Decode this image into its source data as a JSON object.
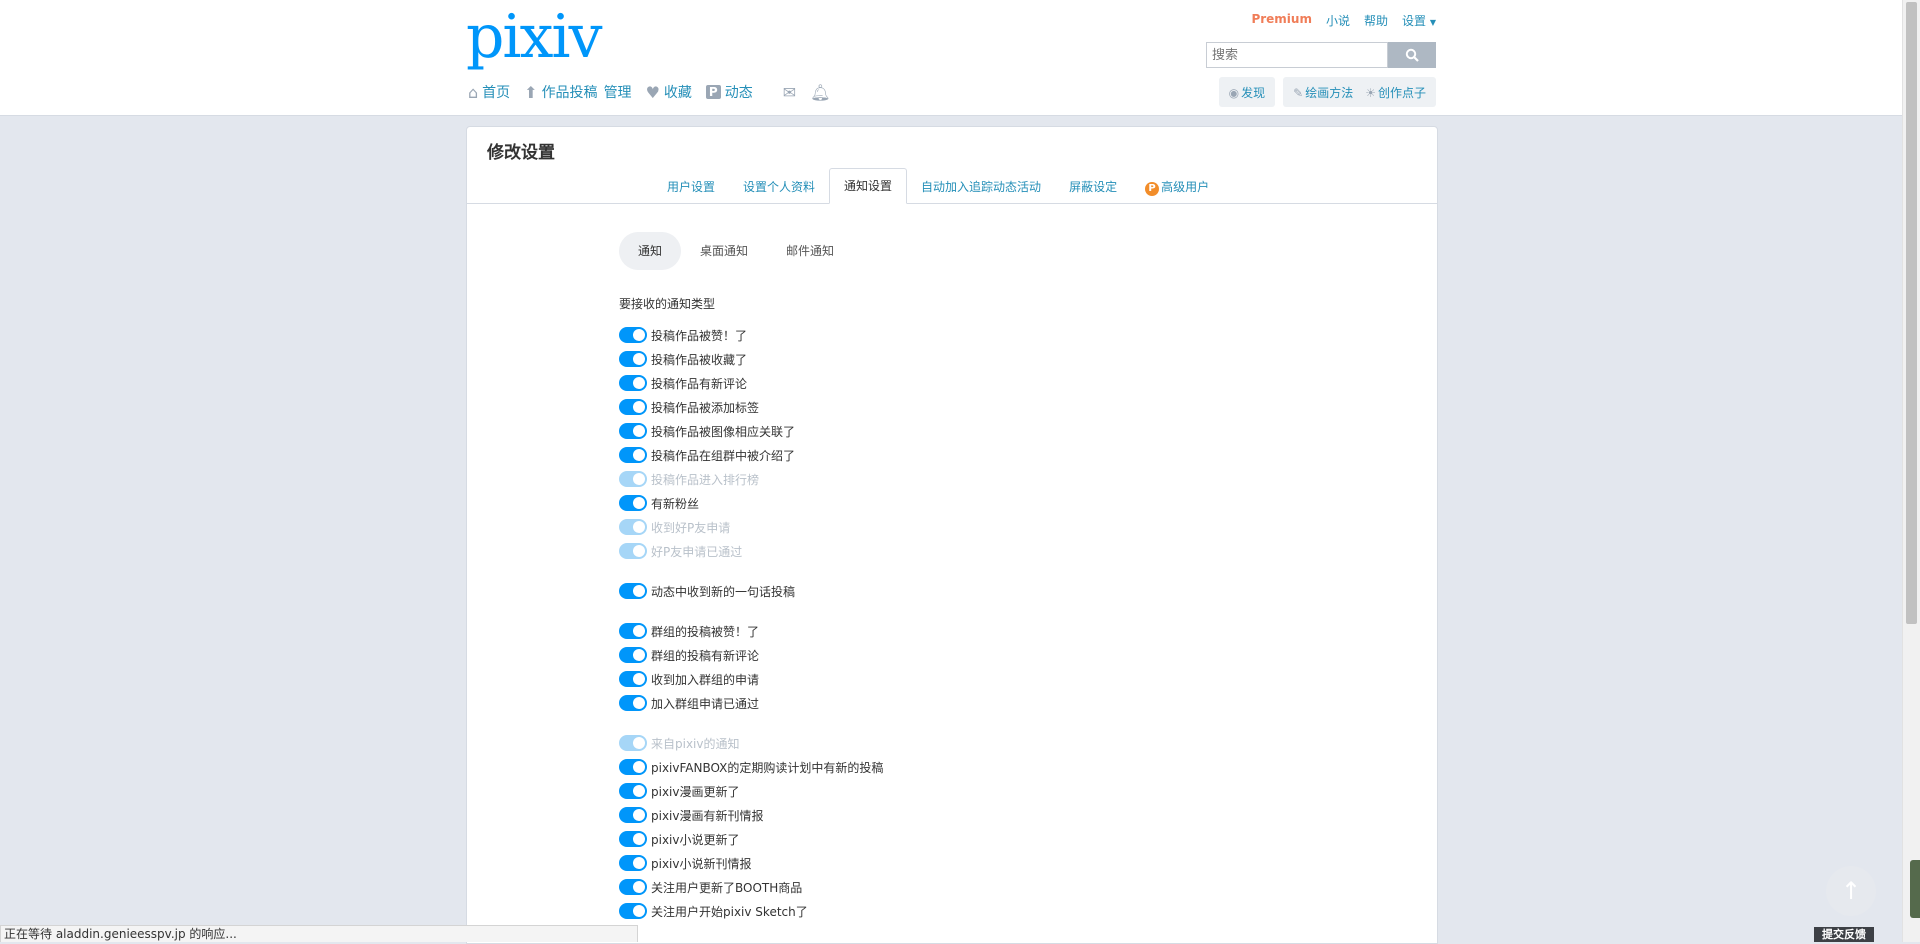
{
  "header": {
    "logo": "pixiv",
    "links": [
      "Premium",
      "小说",
      "帮助",
      "设置"
    ],
    "search_placeholder": "搜索",
    "nav": [
      {
        "label": "首页",
        "icon": "home-icon"
      },
      {
        "label": "作品投稿",
        "icon": "upload-icon"
      },
      {
        "label": "管理",
        "icon": ""
      },
      {
        "label": "收藏",
        "icon": "heart-icon"
      },
      {
        "label": "动态",
        "icon": "pixiv-p-icon"
      }
    ],
    "right_nav": {
      "discover": "发现",
      "howto": "绘画方法",
      "ideas": "创作点子"
    }
  },
  "panel": {
    "title": "修改设置",
    "tabs": [
      "用户设置",
      "设置个人资料",
      "通知设置",
      "自动加入追踪动态活动",
      "屏蔽设定",
      "高级用户"
    ],
    "active_tab": 2,
    "subtabs": [
      "通知",
      "桌面通知",
      "邮件通知"
    ],
    "active_subtab": 0,
    "section_title": "要接收的通知类型",
    "items": [
      {
        "label": "投稿作品被赞！了",
        "on": true,
        "disabled": false
      },
      {
        "label": "投稿作品被收藏了",
        "on": true,
        "disabled": false
      },
      {
        "label": "投稿作品有新评论",
        "on": true,
        "disabled": false
      },
      {
        "label": "投稿作品被添加标签",
        "on": true,
        "disabled": false
      },
      {
        "label": "投稿作品被图像相应关联了",
        "on": true,
        "disabled": false
      },
      {
        "label": "投稿作品在组群中被介绍了",
        "on": true,
        "disabled": false
      },
      {
        "label": "投稿作品进入排行榜",
        "on": true,
        "disabled": true
      },
      {
        "label": "有新粉丝",
        "on": true,
        "disabled": false
      },
      {
        "label": "收到好P友申请",
        "on": true,
        "disabled": true
      },
      {
        "label": "好P友申请已通过",
        "on": true,
        "disabled": true
      },
      {
        "label": "动态中收到新的一句话投稿",
        "on": true,
        "disabled": false,
        "gap": true
      },
      {
        "label": "群组的投稿被赞！了",
        "on": true,
        "disabled": false,
        "gap": true
      },
      {
        "label": "群组的投稿有新评论",
        "on": true,
        "disabled": false
      },
      {
        "label": "收到加入群组的申请",
        "on": true,
        "disabled": false
      },
      {
        "label": "加入群组申请已通过",
        "on": true,
        "disabled": false
      },
      {
        "label": "来自pixiv的通知",
        "on": true,
        "disabled": true,
        "gap": true
      },
      {
        "label": "pixivFANBOX的定期购读计划中有新的投稿",
        "on": true,
        "disabled": false
      },
      {
        "label": "pixiv漫画更新了",
        "on": true,
        "disabled": false
      },
      {
        "label": "pixiv漫画有新刊情报",
        "on": true,
        "disabled": false
      },
      {
        "label": "pixiv小说更新了",
        "on": true,
        "disabled": false
      },
      {
        "label": "pixiv小说新刊情报",
        "on": true,
        "disabled": false
      },
      {
        "label": "关注用户更新了BOOTH商品",
        "on": true,
        "disabled": false
      },
      {
        "label": "关注用户开始pixiv Sketch了",
        "on": true,
        "disabled": false
      }
    ]
  },
  "statusbar": "正在等待 aladdin.genieesspv.jp 的响应...",
  "feedback": "提交反馈",
  "colors": {
    "accent": "#0096fa",
    "link": "#258fb8",
    "premium": "#f07d58"
  }
}
